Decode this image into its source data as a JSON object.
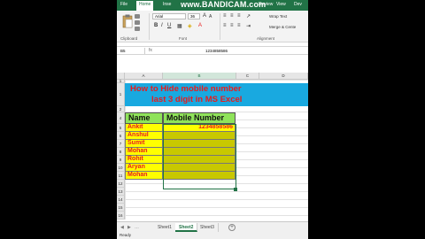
{
  "watermark": "www.BANDICAM.com",
  "ribbon": {
    "tabs": [
      "File",
      "Home",
      "Inse",
      "Review",
      "View",
      "Dev"
    ],
    "active_tab": "Home",
    "font_name": "Arial",
    "font_size": "36",
    "wrap_text": "Wrap Text",
    "merge_center": "Merge & Cente",
    "group_clipboard": "Clipboard",
    "group_font": "Font",
    "group_alignment": "Alignment"
  },
  "formula_bar": {
    "name_box": "B5",
    "fx": "fx",
    "value": "1234858586"
  },
  "columns": [
    "A",
    "B",
    "C",
    "D"
  ],
  "selected_column": "B",
  "rows": [
    "1",
    "2",
    "3",
    "4",
    "5",
    "6",
    "7",
    "8",
    "9",
    "10",
    "11",
    "12",
    "13",
    "14",
    "15",
    "16",
    "17"
  ],
  "title": {
    "line1": "How to Hide mobile number",
    "line2": "last 3 digit in MS Excel"
  },
  "table": {
    "headers": [
      "Name",
      "Mobile Number"
    ],
    "rows": [
      {
        "name": "Ankit",
        "number": "1234858586"
      },
      {
        "name": "Anshul",
        "number": ""
      },
      {
        "name": "Sumit",
        "number": ""
      },
      {
        "name": "Mohan",
        "number": ""
      },
      {
        "name": "Rohit",
        "number": ""
      },
      {
        "name": "Aryan",
        "number": ""
      },
      {
        "name": "Mohan",
        "number": ""
      }
    ]
  },
  "sheets": [
    "Sheet1",
    "Sheet2",
    "Sheet3"
  ],
  "active_sheet": "Sheet2",
  "status": "Ready",
  "colors": {
    "excel_green": "#217346",
    "title_bg": "#19a9e0",
    "title_text": "#e81c1c",
    "header_bg": "#8fe35a",
    "cell_bg": "#ffff00"
  }
}
